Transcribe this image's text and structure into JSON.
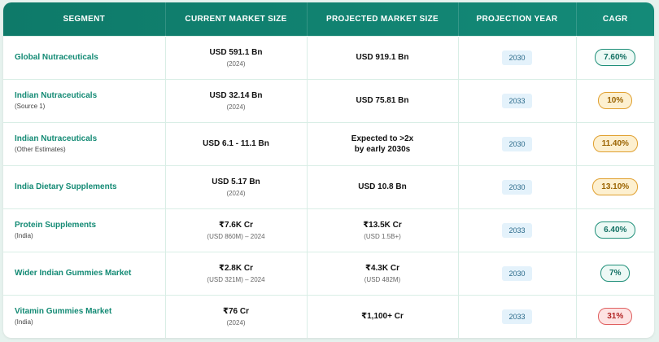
{
  "headers": [
    "SEGMENT",
    "CURRENT MARKET SIZE",
    "PROJECTED MARKET SIZE",
    "PROJECTION YEAR",
    "CAGR"
  ],
  "rows": [
    {
      "segment": "Global Nutraceuticals",
      "segment_sub": "",
      "current": "USD 591.1 Bn",
      "current_sub": "(2024)",
      "projected": "USD 919.1 Bn",
      "projected_sub": "",
      "year": "2030",
      "cagr": "7.60%",
      "cagr_color": "#127063",
      "cagr_style": "green"
    },
    {
      "segment": "Indian Nutraceuticals",
      "segment_sub": "(Source 1)",
      "current": "USD 32.14 Bn",
      "current_sub": "(2024)",
      "projected": "USD 75.81 Bn",
      "projected_sub": "",
      "year": "2033",
      "cagr": "10%",
      "cagr_color": "#9a6300",
      "cagr_style": "orange"
    },
    {
      "segment": "Indian Nutraceuticals",
      "segment_sub": "(Other Estimates)",
      "current": "USD 6.1 - 11.1 Bn",
      "current_sub": "",
      "projected": "Expected to >2x\nby early 2030s",
      "projected_sub": "",
      "year": "2030",
      "cagr": "11.40%",
      "cagr_color": "#9a6300",
      "cagr_style": "orange"
    },
    {
      "segment": "India Dietary Supplements",
      "segment_sub": "",
      "current": "USD 5.17 Bn",
      "current_sub": "(2024)",
      "projected": "USD 10.8 Bn",
      "projected_sub": "",
      "year": "2030",
      "cagr": "13.10%",
      "cagr_color": "#9a6300",
      "cagr_style": "orange"
    },
    {
      "segment": "Protein Supplements",
      "segment_sub": "(India)",
      "current": "₹7.6K Cr",
      "current_sub": "(USD 860M) – 2024",
      "projected": "₹13.5K Cr",
      "projected_sub": "(USD 1.5B+)",
      "year": "2033",
      "cagr": "6.40%",
      "cagr_color": "#127063",
      "cagr_style": "green"
    },
    {
      "segment": "Wider Indian Gummies Market",
      "segment_sub": "",
      "current": "₹2.8K Cr",
      "current_sub": "(USD 321M) – 2024",
      "projected": "₹4.3K Cr",
      "projected_sub": "(USD 482M)",
      "year": "2030",
      "cagr": "7%",
      "cagr_color": "#127063",
      "cagr_style": "green"
    },
    {
      "segment": "Vitamin Gummies Market",
      "segment_sub": "(India)",
      "current": "₹76 Cr",
      "current_sub": "(2024)",
      "projected": "₹1,100+ Cr",
      "projected_sub": "",
      "year": "2033",
      "cagr": "31%",
      "cagr_color": "#b22525",
      "cagr_style": "red"
    }
  ]
}
